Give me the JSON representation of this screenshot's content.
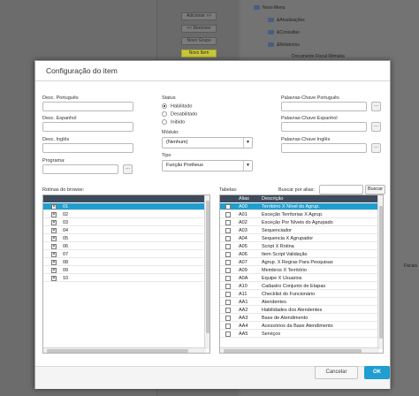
{
  "background": {
    "buttons": [
      "Adicionar >>",
      "<< Remover",
      "Novo Grupo",
      "Novo Item"
    ],
    "tree": {
      "root": "Novo Menu",
      "items": [
        "&Atualizações",
        "&Consultas",
        "&Relatorios",
        "Documento Fiscal Ritmaka"
      ]
    },
    "side_text": "Fiscais"
  },
  "dialog": {
    "title": "Configuração do item",
    "labels": {
      "desc_pt": "Desc. Português",
      "desc_es": "Desc. Espanhol",
      "desc_en": "Desc. Inglês",
      "programa": "Programa:",
      "status": "Status",
      "modulo": "Módulo:",
      "tipo": "Tipo",
      "kw_pt": "Palavras-Chave Português",
      "kw_es": "Palavras-Chave Espanhol",
      "kw_en": "Palavras-Chave Inglês",
      "rotinas": "Rotinas do browse:",
      "tabelas": "Tabelas:",
      "buscar_alias": "Buscar por alias:"
    },
    "status_options": [
      {
        "label": "Habilitado",
        "selected": true
      },
      {
        "label": "Desabilitado",
        "selected": false
      },
      {
        "label": "Inibido",
        "selected": false
      }
    ],
    "modulo_value": "(Nenhum)",
    "tipo_value": "Função Protheus",
    "dots": "...",
    "search_button": "Buscar",
    "rotinas": [
      {
        "label": "01",
        "checked": true
      },
      {
        "label": "02",
        "checked": true
      },
      {
        "label": "03",
        "checked": true
      },
      {
        "label": "04",
        "checked": true
      },
      {
        "label": "05",
        "checked": true
      },
      {
        "label": "06",
        "checked": true
      },
      {
        "label": "07",
        "checked": true
      },
      {
        "label": "08",
        "checked": true
      },
      {
        "label": "09",
        "checked": true
      },
      {
        "label": "10",
        "checked": true
      }
    ],
    "tabelas_headers": {
      "alias": "Alias",
      "descricao": "Descrição"
    },
    "tabelas": [
      {
        "alias": "A00",
        "desc": "Território X Nível do Agrup."
      },
      {
        "alias": "A01",
        "desc": "Exceção Territorias X Agrup."
      },
      {
        "alias": "A02",
        "desc": "Exceção Por Níveis do Agrupado"
      },
      {
        "alias": "A03",
        "desc": "Sequenciador"
      },
      {
        "alias": "A04",
        "desc": "Sequencia X Agrupador"
      },
      {
        "alias": "A05",
        "desc": "Script X Rotina"
      },
      {
        "alias": "A06",
        "desc": "Item Script Validação"
      },
      {
        "alias": "A07",
        "desc": "Agrup. X Regras Para Pesquisas"
      },
      {
        "alias": "A09",
        "desc": "Membros X Território"
      },
      {
        "alias": "A0A",
        "desc": "Equipe X Usuarios"
      },
      {
        "alias": "A10",
        "desc": "Cadastro Conjunto de Etapas"
      },
      {
        "alias": "A11",
        "desc": "Checklist do Funcionário"
      },
      {
        "alias": "AA1",
        "desc": "Atendentes"
      },
      {
        "alias": "AA2",
        "desc": "Habilidades dos Atendentes"
      },
      {
        "alias": "AA3",
        "desc": "Base de Atendimento"
      },
      {
        "alias": "AA4",
        "desc": "Acessórios da Base Atendimento"
      },
      {
        "alias": "AA5",
        "desc": "Serviços"
      }
    ],
    "cancel": "Cancelar",
    "ok": "OK",
    "colors": {
      "accent": "#1f9ecf",
      "header": "#3f4a5a"
    }
  }
}
